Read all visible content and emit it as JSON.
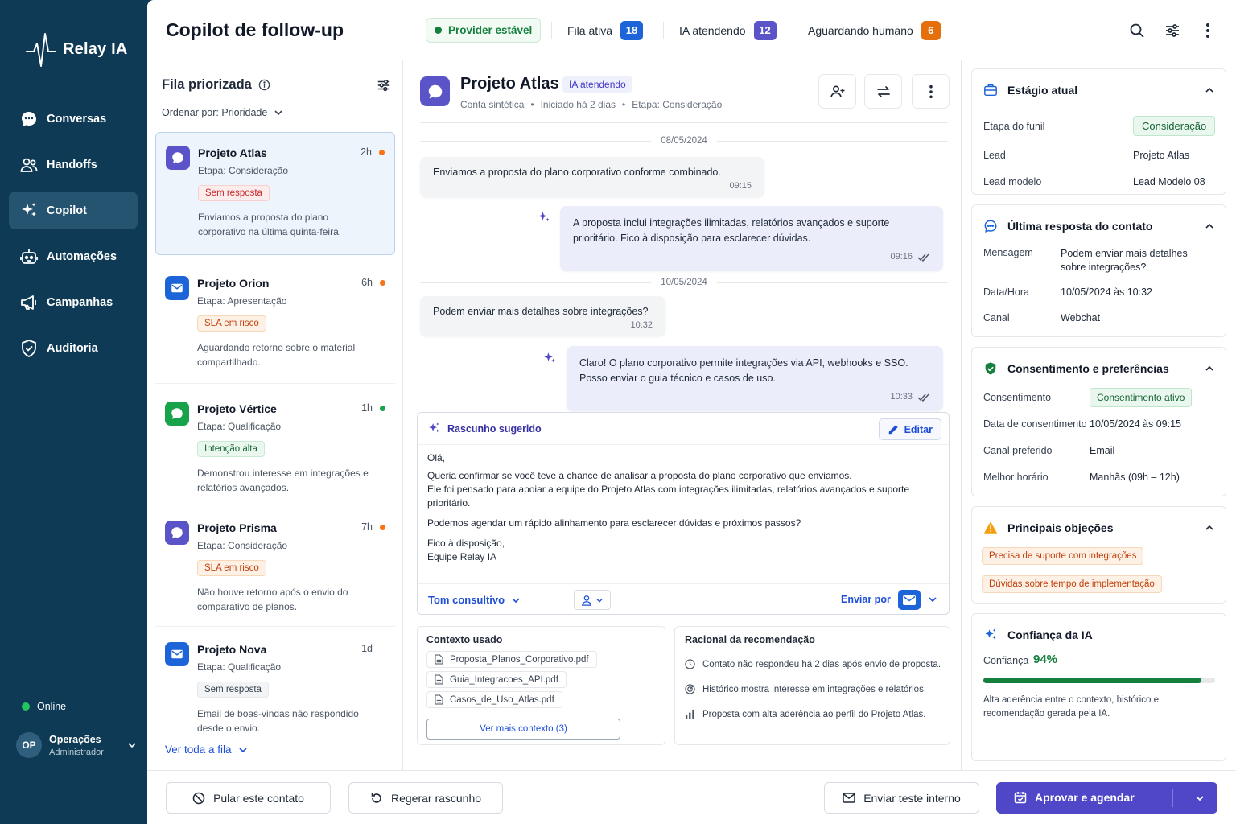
{
  "brand": {
    "name": "Relay IA"
  },
  "nav": [
    {
      "label": "Conversas",
      "icon": "chat-icon",
      "active": false
    },
    {
      "label": "Handoffs",
      "icon": "users-icon",
      "active": false
    },
    {
      "label": "Copilot",
      "icon": "sparkles-icon",
      "active": true
    },
    {
      "label": "Automações",
      "icon": "robot-icon",
      "active": false
    },
    {
      "label": "Campanhas",
      "icon": "megaphone-icon",
      "active": false
    },
    {
      "label": "Auditoria",
      "icon": "shield-check-icon",
      "active": false
    }
  ],
  "status": {
    "online_label": "Online",
    "online_color": "#22c55e"
  },
  "user": {
    "initials": "OP",
    "name": "Operações",
    "role": "Administrador"
  },
  "header": {
    "title": "Copilot de follow-up",
    "provider_status": "Provider estável",
    "stats": [
      {
        "label": "Fila ativa",
        "count": "18",
        "color": "#1d64d8"
      },
      {
        "label": "IA atendendo",
        "count": "12",
        "color": "#5b54c9"
      },
      {
        "label": "Aguardando humano",
        "count": "6",
        "color": "#e46f0d"
      }
    ]
  },
  "queue": {
    "title": "Fila priorizada",
    "order_label": "Ordenar por: Prioridade",
    "see_all": "Ver toda a fila",
    "items": [
      {
        "name": "Projeto Atlas",
        "time": "2h",
        "stage": "Etapa: Consideração",
        "tag": "Sem resposta",
        "tag_style": "red",
        "desc": "Enviamos a proposta do plano corporativo na última quinta-feira.",
        "channel": "chat",
        "icon_color": "#5b54c9",
        "dot_color": "#f97316"
      },
      {
        "name": "Projeto Orion",
        "time": "6h",
        "stage": "Etapa: Apresentação",
        "tag": "SLA em risco",
        "tag_style": "orange",
        "desc": "Aguardando retorno sobre o material compartilhado.",
        "channel": "email",
        "icon_color": "#1d64d8",
        "dot_color": "#f97316"
      },
      {
        "name": "Projeto Vértice",
        "time": "1h",
        "stage": "Etapa: Qualificação",
        "tag": "Intenção alta",
        "tag_style": "green",
        "desc": "Demonstrou interesse em integrações e relatórios avançados.",
        "channel": "whatsapp",
        "icon_color": "#16a34a",
        "dot_color": "#16a34a"
      },
      {
        "name": "Projeto Prisma",
        "time": "7h",
        "stage": "Etapa: Consideração",
        "tag": "SLA em risco",
        "tag_style": "orange",
        "desc": "Não houve retorno após o envio do comparativo de planos.",
        "channel": "chat",
        "icon_color": "#5b54c9",
        "dot_color": "#f97316"
      },
      {
        "name": "Projeto Nova",
        "time": "1d",
        "stage": "Etapa: Qualificação",
        "tag": "Sem resposta",
        "tag_style": "gray",
        "desc": "Email de boas-vindas não respondido desde o envio.",
        "channel": "email",
        "icon_color": "#1d64d8",
        "dot_color": ""
      }
    ]
  },
  "conversation": {
    "title": "Projeto Atlas",
    "badge": "IA atendendo",
    "meta": [
      "Conta sintética",
      "•",
      "Iniciado há 2 dias",
      "•",
      "Etapa: Consideração"
    ],
    "date1": "08/05/2024",
    "date2": "10/05/2024",
    "messages": [
      {
        "dir": "in",
        "text": "Enviamos a proposta do plano corporativo conforme combinado.",
        "time": "09:15"
      },
      {
        "dir": "out",
        "text": "A proposta inclui integrações ilimitadas, relatórios avançados e suporte prioritário. Fico à disposição para esclarecer dúvidas.",
        "time": "09:16"
      },
      {
        "dir": "in",
        "text": "Podem enviar mais detalhes sobre integrações?",
        "time": "10:32"
      },
      {
        "dir": "out",
        "text": "Claro! O plano corporativo permite integrações via API, webhooks e SSO. Posso enviar o guia técnico e casos de uso.",
        "time": "10:33"
      }
    ],
    "draft": {
      "title": "Rascunho sugerido",
      "edit_label": "Editar",
      "lines": [
        "Olá,",
        "",
        "Queria confirmar se você teve a chance de analisar a proposta do plano corporativo que enviamos.",
        "Ele foi pensado para apoiar a equipe do Projeto Atlas com integrações ilimitadas, relatórios avançados e suporte prioritário.",
        "",
        "Podemos agendar um rápido alinhamento para esclarecer dúvidas e próximos passos?",
        "",
        "Fico à disposição,",
        "Equipe Relay IA"
      ],
      "tone": "Tom consultivo",
      "send_by": "Enviar por"
    },
    "context": {
      "title": "Contexto usado",
      "files": [
        "Proposta_Planos_Corporativo.pdf",
        "Guia_Integracoes_API.pdf",
        "Casos_de_Uso_Atlas.pdf"
      ],
      "more": "Ver mais contexto (3)"
    },
    "rationale": {
      "title": "Racional da recomendação",
      "items": [
        {
          "icon": "clock-icon",
          "text": "Contato não respondeu há 2 dias após envio de proposta."
        },
        {
          "icon": "target-icon",
          "text": "Histórico mostra interesse em integrações e relatórios."
        },
        {
          "icon": "bar-chart-icon",
          "text": "Proposta com alta aderência ao perfil do Projeto Atlas."
        }
      ]
    }
  },
  "stage": {
    "title": "Estágio atual",
    "rows": [
      {
        "k": "Etapa do funil",
        "v": "Consideração"
      },
      {
        "k": "Lead",
        "v": "Projeto Atlas"
      },
      {
        "k": "Lead modelo",
        "v": "Lead Modelo 08"
      }
    ]
  },
  "last_reply": {
    "title": "Última resposta do contato",
    "rows": [
      {
        "k": "Mensagem",
        "v": "Podem enviar mais detalhes sobre integrações?"
      },
      {
        "k": "Data/Hora",
        "v": "10/05/2024 às 10:32"
      },
      {
        "k": "Canal",
        "v": "Webchat"
      }
    ]
  },
  "consent": {
    "title": "Consentimento e preferências",
    "rows": [
      {
        "k": "Consentimento",
        "v": "Consentimento ativo"
      },
      {
        "k": "Data de consentimento",
        "v": "10/05/2024 às 09:15"
      },
      {
        "k": "Canal preferido",
        "v": "Email"
      },
      {
        "k": "Melhor horário",
        "v": "Manhãs (09h – 12h)"
      }
    ]
  },
  "objections": {
    "title": "Principais objeções",
    "items": [
      "Precisa de suporte com integrações",
      "Dúvidas sobre tempo de implementação"
    ]
  },
  "confidence": {
    "title": "Confiança da IA",
    "label": "Confiança",
    "value_text": "94%",
    "value": 0.94,
    "note": "Alta aderência entre o contexto, histórico e recomendação gerada pela IA."
  },
  "footer": {
    "skip": "Pular este contato",
    "regen": "Regerar rascunho",
    "test": "Enviar teste interno",
    "approve": "Aprovar e agendar"
  }
}
